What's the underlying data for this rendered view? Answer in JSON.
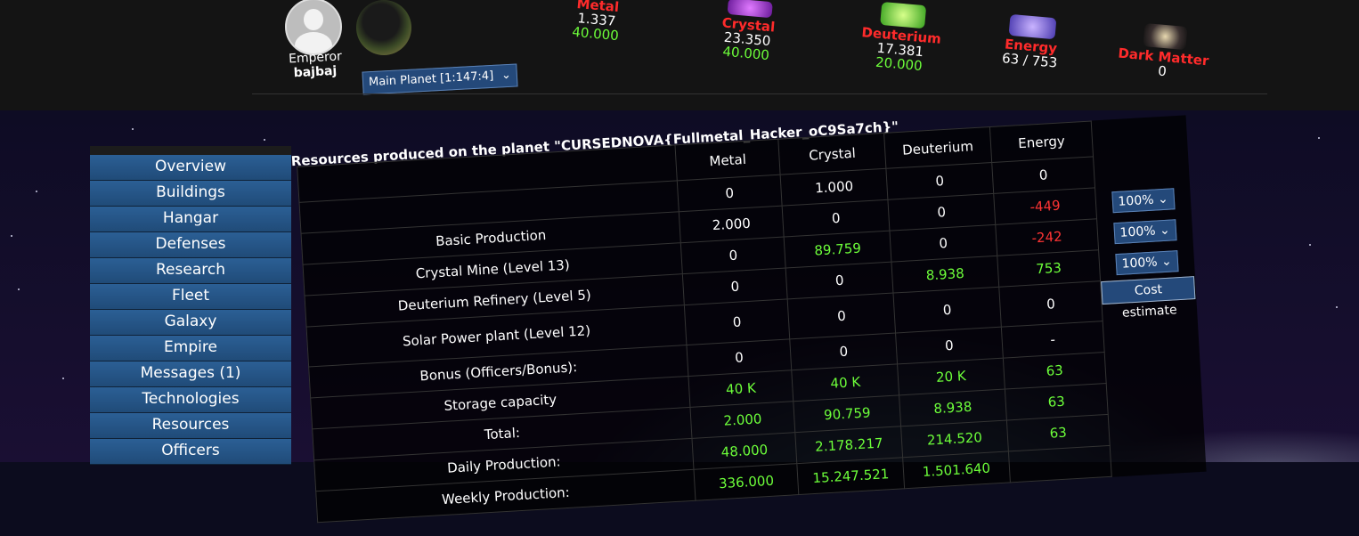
{
  "header": {
    "rank": "Emperor",
    "username": "bajbaj",
    "planet_select": "Main Planet [1:147:4]",
    "resources": [
      {
        "name": "Metal",
        "current": "1.337",
        "production": "40.000",
        "icon": "metal-icon"
      },
      {
        "name": "Crystal",
        "current": "23.350",
        "production": "40.000",
        "icon": "crystal-icon"
      },
      {
        "name": "Deuterium",
        "current": "17.381",
        "production": "20.000",
        "icon": "deuterium-icon"
      },
      {
        "name": "Energy",
        "current": "63 / 753",
        "production": "",
        "icon": "energy-icon"
      },
      {
        "name": "Dark Matter",
        "current": "0",
        "production": "",
        "icon": "dark-matter-icon"
      }
    ]
  },
  "menu": [
    "Overview",
    "Buildings",
    "Hangar",
    "Defenses",
    "Research",
    "Fleet",
    "Galaxy",
    "Empire",
    "Messages (1)",
    "Technologies",
    "Resources",
    "Officers"
  ],
  "content": {
    "title": "Resources produced on the planet \"CURSEDNOVA{Fullmetal_Hacker_oC9Sa7ch}\"",
    "columns": [
      "Metal",
      "Crystal",
      "Deuterium",
      "Energy"
    ],
    "row_top": [
      "0",
      "1.000",
      "0",
      "0"
    ],
    "rows": [
      {
        "label": "Basic Production",
        "values": [
          "2.000",
          "0",
          "0",
          "-449"
        ],
        "colors": [
          "w",
          "w",
          "w",
          "r"
        ],
        "control": "100%"
      },
      {
        "label": "Crystal Mine (Level 13)",
        "values": [
          "0",
          "89.759",
          "0",
          "-242"
        ],
        "colors": [
          "w",
          "g",
          "w",
          "r"
        ],
        "control": "100%"
      },
      {
        "label": "Deuterium Refinery (Level 5)",
        "values": [
          "0",
          "0",
          "8.938",
          "753"
        ],
        "colors": [
          "w",
          "w",
          "g",
          "g"
        ],
        "control": "100%"
      },
      {
        "label": "Solar Power plant (Level 12)",
        "values": [
          "0",
          "0",
          "0",
          "0"
        ],
        "colors": [
          "w",
          "w",
          "w",
          "w"
        ],
        "control": "Cost estimate"
      },
      {
        "label": "Bonus (Officers/Bonus):",
        "values": [
          "0",
          "0",
          "0",
          "-"
        ],
        "colors": [
          "w",
          "w",
          "w",
          "w"
        ],
        "control": ""
      },
      {
        "label": "Storage capacity",
        "values": [
          "40 K",
          "40 K",
          "20 K",
          "63"
        ],
        "colors": [
          "g",
          "g",
          "g",
          "g"
        ],
        "control": ""
      },
      {
        "label": "Total:",
        "values": [
          "2.000",
          "90.759",
          "8.938",
          "63"
        ],
        "colors": [
          "g",
          "g",
          "g",
          "g"
        ],
        "control": ""
      },
      {
        "label": "Daily Production:",
        "values": [
          "48.000",
          "2.178.217",
          "214.520",
          "63"
        ],
        "colors": [
          "g",
          "g",
          "g",
          "g"
        ],
        "control": ""
      },
      {
        "label": "Weekly Production:",
        "values": [
          "336.000",
          "15.247.521",
          "1.501.640",
          ""
        ],
        "colors": [
          "g",
          "g",
          "g",
          "g"
        ],
        "control": ""
      }
    ]
  }
}
